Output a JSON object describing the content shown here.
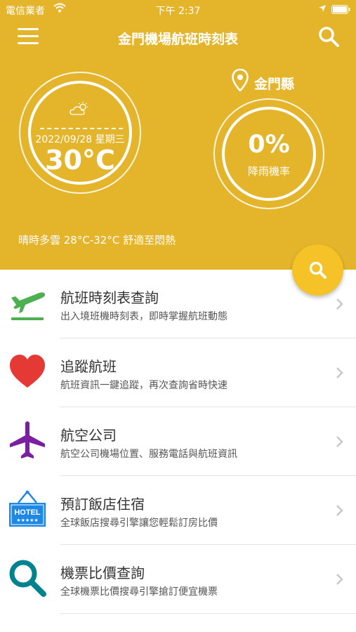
{
  "status_bar": {
    "carrier": "電信業者",
    "time": "下午 2:37"
  },
  "nav": {
    "title": "金門機場航班時刻表"
  },
  "weather": {
    "date": "2022/09/28 星期三",
    "temperature": "30°C",
    "summary": "晴時多雲 28°C-32°C 舒適至悶熱"
  },
  "location": {
    "name": "金門縣"
  },
  "rain": {
    "percent": "0%",
    "label": "降雨機率"
  },
  "menu_items": [
    {
      "icon": "departure-plane-icon",
      "color": "#4caf50",
      "title": "航班時刻表查詢",
      "subtitle": "出入境班機時刻表，即時掌握航班動態"
    },
    {
      "icon": "heart-icon",
      "color": "#e53935",
      "title": "追蹤航班",
      "subtitle": "航班資訊一鍵追蹤，再次查詢省時快速"
    },
    {
      "icon": "airplane-icon",
      "color": "#7b1fa2",
      "title": "航空公司",
      "subtitle": "航空公司機場位置、服務電話與航班資訊"
    },
    {
      "icon": "hotel-sign-icon",
      "color": "#1e88e5",
      "title": "預訂飯店住宿",
      "subtitle": "全球飯店搜尋引擎讓您輕鬆訂房比價",
      "icon_text": "HOTEL"
    },
    {
      "icon": "magnifier-icon",
      "color": "#00838f",
      "title": "機票比價查詢",
      "subtitle": "全球機票比價搜尋引擎搶訂便宜機票"
    }
  ],
  "colors": {
    "header": "#e4b52b",
    "fab": "#f5c227"
  }
}
